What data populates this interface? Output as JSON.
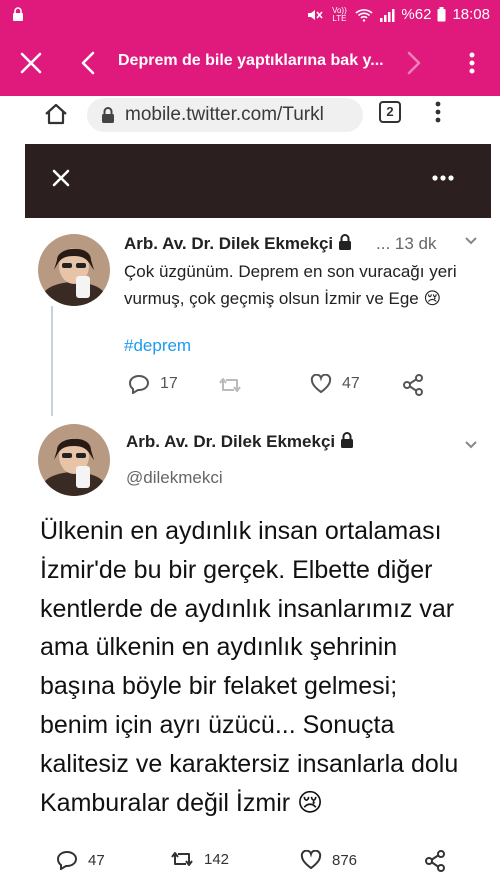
{
  "status_bar": {
    "network": "Vo)) LTE",
    "battery": "%62",
    "time": "18:08",
    "icons": [
      "lock-icon",
      "mute-icon",
      "wifi-icon",
      "signal-icon",
      "battery-icon"
    ]
  },
  "app_bar": {
    "title": "Deprem de bile yaptıklarına bak y...",
    "icons": [
      "close-icon",
      "back-icon",
      "forward-icon",
      "more-vert-icon"
    ]
  },
  "browser": {
    "url": "mobile.twitter.com/Turkl",
    "tab_count": "2"
  },
  "tweet_reply": {
    "author": "Arb. Av. Dr. Dilek Ekmekçi",
    "time": "... 13 dk",
    "text": "Çok üzgünüm. Deprem en son vuracağı yeri vurmuş, çok geçmiş olsun İzmir ve Ege 😢",
    "hashtag": "#deprem",
    "replies": "17",
    "likes": "47"
  },
  "tweet_main": {
    "author": "Arb. Av. Dr. Dilek Ekmekçi",
    "handle": "@dilekmekci",
    "text": "Ülkenin en aydınlık insan ortalaması İzmir'de bu bir gerçek. Elbette diğer kentlerde de aydınlık insanlarımız var ama ülkenin en aydınlık şehrinin başına böyle bir felaket gelmesi; benim için ayrı üzücü... Sonuçta kalitesiz ve karaktersiz insanlarla dolu Kamburalar değil İzmir 😢"
  },
  "bottom_actions": {
    "replies": "47",
    "retweets": "142",
    "likes": "876"
  },
  "colors": {
    "accent": "#e0197d",
    "dark_header": "#2b1f1f",
    "link": "#1d9bf0"
  }
}
